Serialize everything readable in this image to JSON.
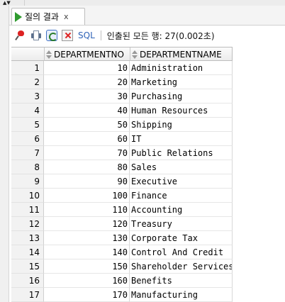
{
  "tab": {
    "label": "질의 결과",
    "close": "x"
  },
  "toolbar": {
    "sql_label": "SQL",
    "status": "인출된 모든 행: 27(0.002초)"
  },
  "grid": {
    "columns": [
      "DEPARTMENTNO",
      "DEPARTMENTNAME"
    ],
    "rows": [
      {
        "n": "1",
        "no": "10",
        "name": "Administration"
      },
      {
        "n": "2",
        "no": "20",
        "name": "Marketing"
      },
      {
        "n": "3",
        "no": "30",
        "name": "Purchasing"
      },
      {
        "n": "4",
        "no": "40",
        "name": "Human Resources"
      },
      {
        "n": "5",
        "no": "50",
        "name": "Shipping"
      },
      {
        "n": "6",
        "no": "60",
        "name": "IT"
      },
      {
        "n": "7",
        "no": "70",
        "name": "Public Relations"
      },
      {
        "n": "8",
        "no": "80",
        "name": "Sales"
      },
      {
        "n": "9",
        "no": "90",
        "name": "Executive"
      },
      {
        "n": "10",
        "no": "100",
        "name": "Finance"
      },
      {
        "n": "11",
        "no": "110",
        "name": "Accounting"
      },
      {
        "n": "12",
        "no": "120",
        "name": "Treasury"
      },
      {
        "n": "13",
        "no": "130",
        "name": "Corporate Tax"
      },
      {
        "n": "14",
        "no": "140",
        "name": "Control And Credit"
      },
      {
        "n": "15",
        "no": "150",
        "name": "Shareholder Services"
      },
      {
        "n": "16",
        "no": "160",
        "name": "Benefits"
      },
      {
        "n": "17",
        "no": "170",
        "name": "Manufacturing"
      }
    ]
  },
  "colors": {
    "play_green": "#2e9a2e",
    "sql_blue": "#2f63b7"
  }
}
